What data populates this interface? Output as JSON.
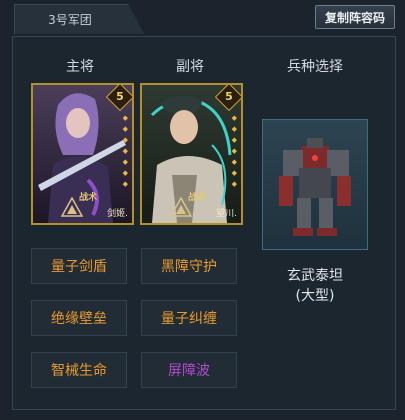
{
  "team_tab": "3号军团",
  "copy_button": "复制阵容码",
  "columns": {
    "main_general": "主将",
    "vice_general": "副将",
    "troop_select": "兵种选择"
  },
  "cards": [
    {
      "star": "5",
      "tactic": "战术",
      "name": "剑姬.",
      "color_hair": "#8a6fb7"
    },
    {
      "star": "5",
      "tactic": "战术",
      "name": "望川.",
      "color_hair": "#3fd2c9"
    }
  ],
  "skills": {
    "main": [
      "量子剑盾",
      "绝缘壁垒",
      "智械生命"
    ],
    "vice": [
      "黑障守护",
      "量子纠缠",
      "屏障波"
    ]
  },
  "troop": {
    "name": "玄武泰坦",
    "size": "(大型)"
  },
  "colors": {
    "skill_orange": "#e89a2e",
    "skill_purple": "#b04ad0",
    "card_gold": "#b4902c"
  }
}
